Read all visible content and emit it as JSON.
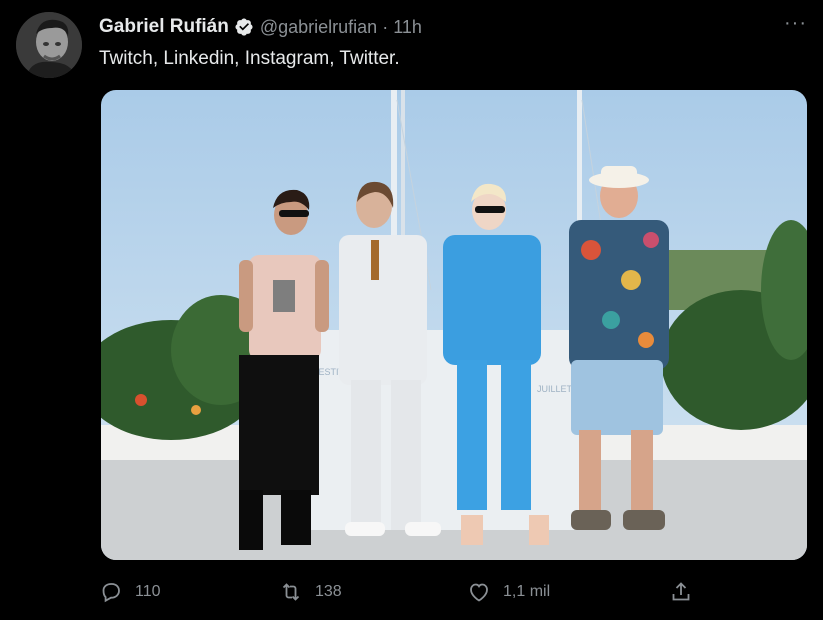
{
  "tweet": {
    "author_name": "Gabriel Rufián",
    "handle": "@gabrielrufian",
    "separator": "·",
    "time": "11h",
    "text": "Twitch, Linkedin, Instagram, Twitter.",
    "more_label": "···",
    "verified_color": "#e7e9ea"
  },
  "actions": {
    "reply_count": "110",
    "retweet_count": "138",
    "like_count": "1,1 mil"
  },
  "icons": [
    "verified-badge-icon",
    "more-icon",
    "reply-icon",
    "retweet-icon",
    "like-icon",
    "share-icon"
  ],
  "colors": {
    "background": "#000000",
    "text": "#e7e9ea",
    "muted": "#8b9095"
  }
}
